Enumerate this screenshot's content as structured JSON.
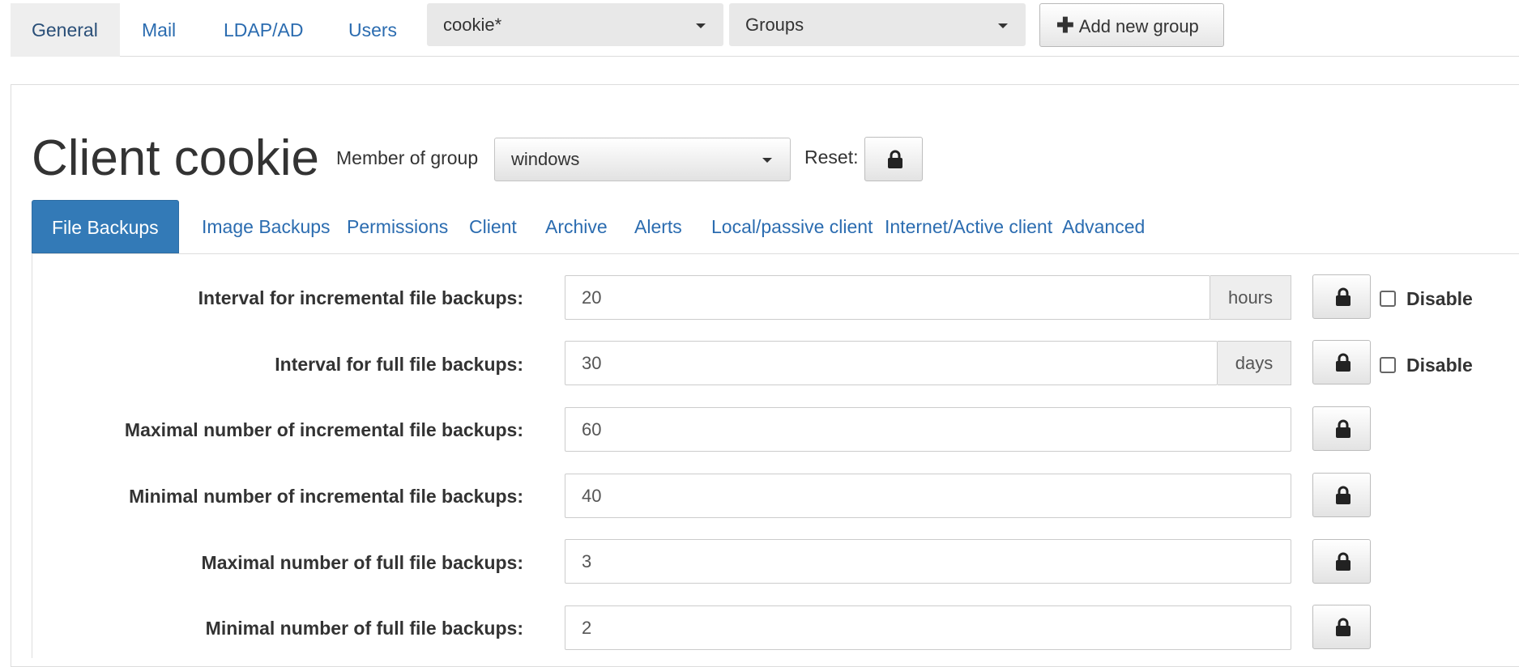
{
  "top_nav": {
    "tabs": [
      {
        "label": "General"
      },
      {
        "label": "Mail"
      },
      {
        "label": "LDAP/AD"
      },
      {
        "label": "Users"
      }
    ],
    "client_select": "cookie*",
    "groups_select": "Groups",
    "add_group_label": "Add new group"
  },
  "client": {
    "title": "Client cookie",
    "member_label": "Member of group",
    "group_value": "windows",
    "reset_label": "Reset:"
  },
  "sub_tabs": [
    {
      "label": "File Backups"
    },
    {
      "label": "Image Backups"
    },
    {
      "label": "Permissions"
    },
    {
      "label": "Client"
    },
    {
      "label": "Archive"
    },
    {
      "label": "Alerts"
    },
    {
      "label": "Local/passive client"
    },
    {
      "label": "Internet/Active client"
    },
    {
      "label": "Advanced"
    }
  ],
  "settings": [
    {
      "label": "Interval for incremental file backups:",
      "value": "20",
      "unit": "hours",
      "disable_label": "Disable"
    },
    {
      "label": "Interval for full file backups:",
      "value": "30",
      "unit": "days",
      "disable_label": "Disable"
    },
    {
      "label": "Maximal number of incremental file backups:",
      "value": "60"
    },
    {
      "label": "Minimal number of incremental file backups:",
      "value": "40"
    },
    {
      "label": "Maximal number of full file backups:",
      "value": "3"
    },
    {
      "label": "Minimal number of full file backups:",
      "value": "2"
    }
  ],
  "icons": {
    "lock": "lock-icon",
    "plus": "plus-icon",
    "caret": "caret-down-icon"
  },
  "colors": {
    "link": "#2b6cb0",
    "active_tab_bg": "#337ab7"
  }
}
